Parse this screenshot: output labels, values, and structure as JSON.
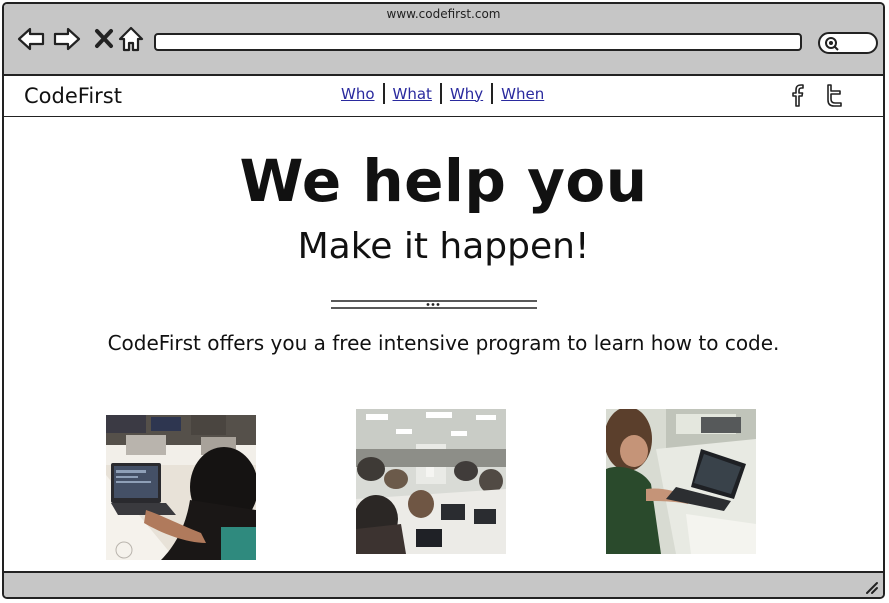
{
  "browser": {
    "title": "www.codefirst.com",
    "address_value": "",
    "search_placeholder": ""
  },
  "site": {
    "brand": "CodeFirst",
    "nav": [
      {
        "label": "Who"
      },
      {
        "label": "What"
      },
      {
        "label": "Why"
      },
      {
        "label": "When"
      }
    ],
    "social": [
      "facebook-icon",
      "twitter-icon"
    ]
  },
  "hero": {
    "title": "We help you",
    "subtitle": "Make it happen!",
    "lead": "CodeFirst offers you a free intensive program to learn how to code."
  },
  "photos": [
    {
      "kind": "person-laptop-closeup"
    },
    {
      "kind": "classroom-wide"
    },
    {
      "kind": "person-laptop-side"
    }
  ],
  "colors": {
    "chrome": "#c6c6c6",
    "link": "#2a2a9e",
    "ink": "#111111"
  }
}
